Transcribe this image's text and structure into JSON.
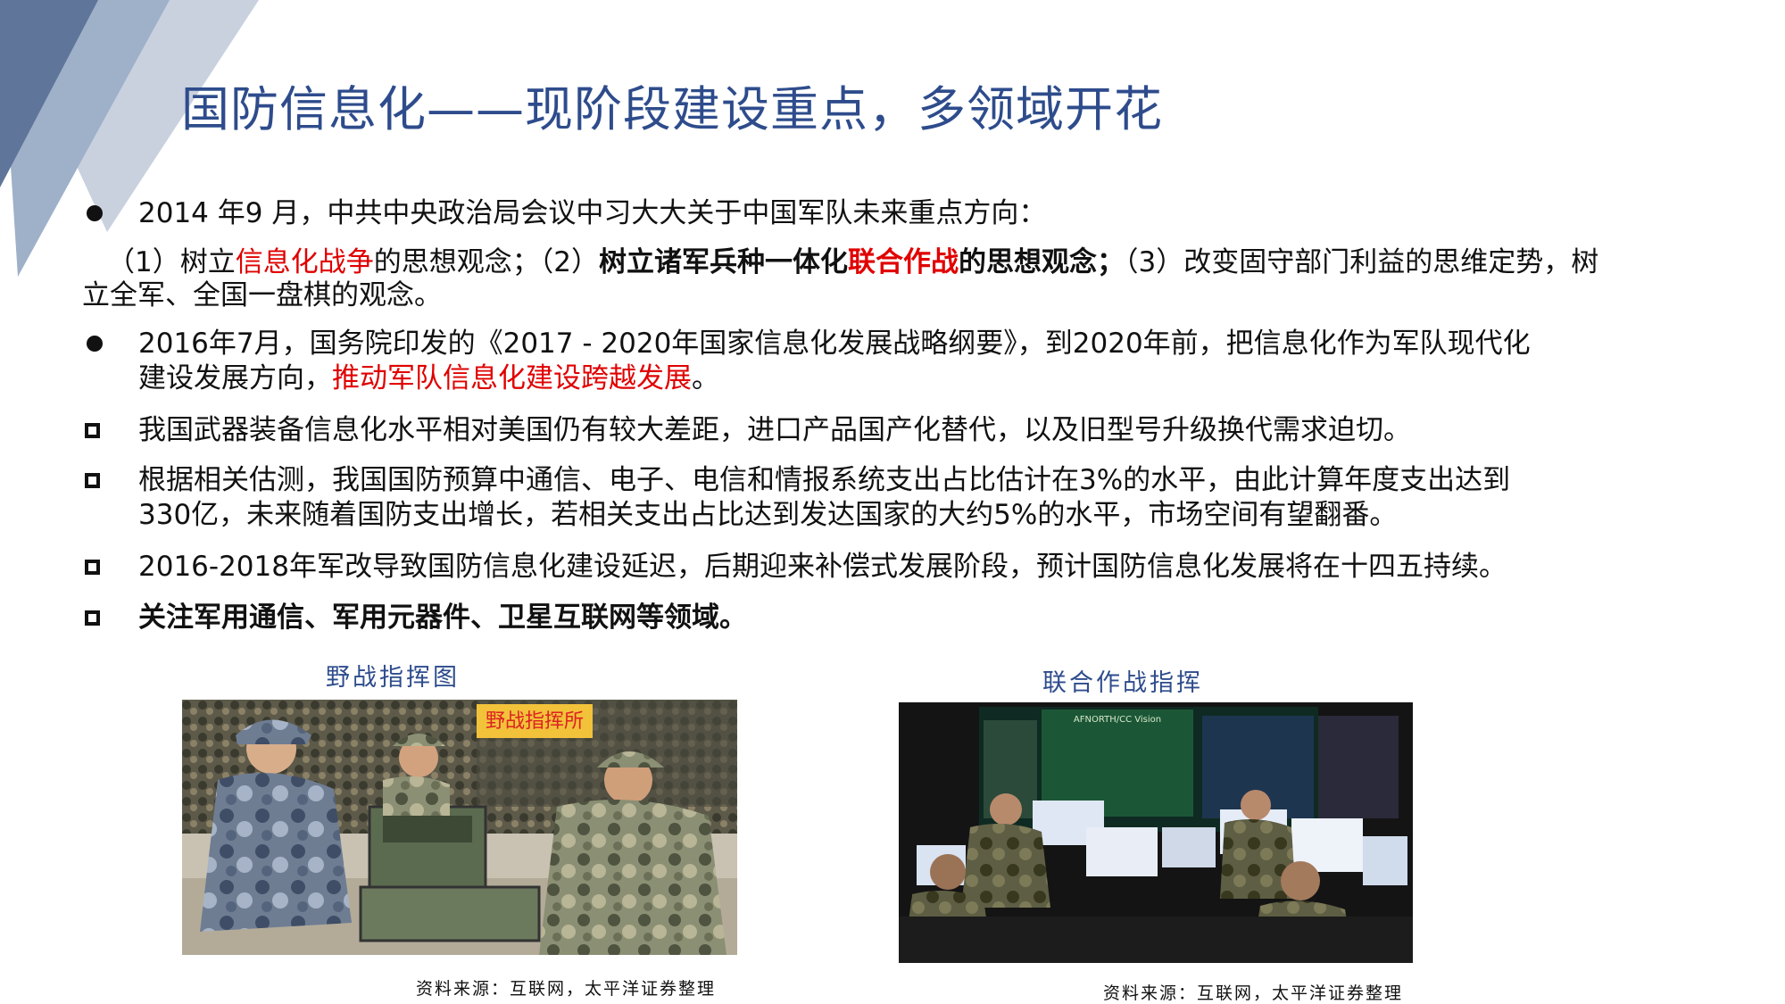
{
  "title": "国防信息化——现阶段建设重点，多领域开花",
  "p1": {
    "text": "2014 年9 月，中共中央政治局会议中习大大关于中国军队未来重点方向："
  },
  "p1b": {
    "a": "（1）树立",
    "b": "信息化战争",
    "c": "的思想观念；（2）",
    "d": "树立诸军兵种一体化",
    "e": "联合作战",
    "f": "的思想观念；",
    "g": "（3）改变固守部门利益的思维定势，树",
    "line2": "立全军、全国一盘棋的观念。"
  },
  "p2": {
    "line1": "2016年7月，国务院印发的《2017 - 2020年国家信息化发展战略纲要》，到2020年前，把信息化作为军队现代化",
    "line2a": "建设发展方向，",
    "line2b": "推动军队信息化建设跨越发展",
    "line2c": "。"
  },
  "p3": {
    "text": "我国武器装备信息化水平相对美国仍有较大差距，进口产品国产化替代，以及旧型号升级换代需求迫切。"
  },
  "p4": {
    "line1": "根据相关估测，我国国防预算中通信、电子、电信和情报系统支出占比估计在3%的水平，由此计算年度支出达到",
    "line2": "330亿，未来随着国防支出增长，若相关支出占比达到发达国家的大约5%的水平，市场空间有望翻番。"
  },
  "p5": {
    "text": "2016-2018年军改导致国防信息化建设延迟，后期迎来补偿式发展阶段，预计国防信息化发展将在十四五持续。"
  },
  "p6": {
    "text": "关注军用通信、军用元器件、卫星互联网等领域。"
  },
  "figures": [
    {
      "caption": "野战指挥图",
      "sign_text": "野战指挥所",
      "source": "资料来源：互联网，太平洋证券整理"
    },
    {
      "caption": "联合作战指挥",
      "screen_text": "AFNORTH/CC Vision",
      "source": "资料来源：互联网，太平洋证券整理"
    }
  ],
  "colors": {
    "accent": "#2e4c8c",
    "highlight": "#e00000"
  }
}
